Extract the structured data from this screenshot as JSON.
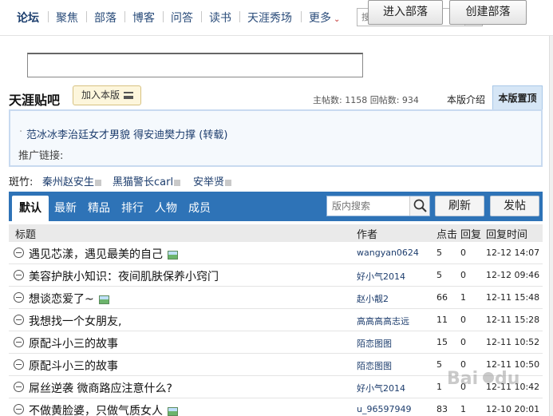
{
  "nav": {
    "items": [
      "论坛",
      "聚焦",
      "部落",
      "博客",
      "问答",
      "读书",
      "天涯秀场",
      "更多"
    ],
    "more_arrow": "⌄",
    "search_placeholder": "搜帖、找人、搜版块"
  },
  "create_bar": {
    "input_value": "",
    "enter_label": "进入部落",
    "create_label": "创建部落"
  },
  "board": {
    "title": "天涯贴吧",
    "join_label": "加入本版",
    "stats": "主帖数: 1158  回帖数: 934",
    "tab_intro": "本版介绍",
    "tab_settings": "本版置顶"
  },
  "notice": {
    "link_text": "范冰冰李治廷女才男貌 得安迪樊力撑 (转载)",
    "promo_label": "推广链接:"
  },
  "moderators": {
    "label": "斑竹:",
    "names": [
      "秦州赵安生",
      "黑猫警长carl",
      "安举贤"
    ]
  },
  "tabs": {
    "items": [
      "默认",
      "最新",
      "精品",
      "排行",
      "人物",
      "成员"
    ],
    "search_placeholder": "版内搜索",
    "refresh_label": "刷新",
    "post_label": "发帖"
  },
  "table": {
    "headers": {
      "title": "标题",
      "author": "作者",
      "clicks": "点击",
      "replies": "回复",
      "time": "回复时间"
    },
    "rows": [
      {
        "title": "遇见芯漾，遇见最美的自己",
        "has_image": true,
        "author": "wangyan0624",
        "clicks": "5",
        "replies": "0",
        "time": "12-12 14:07"
      },
      {
        "title": "美容护肤小知识：夜间肌肤保养小窍门",
        "has_image": false,
        "author": "好小气2014",
        "clicks": "5",
        "replies": "0",
        "time": "12-12 09:46"
      },
      {
        "title": "想谈恋爱了~",
        "has_image": true,
        "author": "赵小靓2",
        "clicks": "66",
        "replies": "1",
        "time": "12-11 15:48"
      },
      {
        "title": "我想找一个女朋友,",
        "has_image": false,
        "author": "高高高高志远",
        "clicks": "11",
        "replies": "0",
        "time": "12-11 15:28"
      },
      {
        "title": "原配斗小三的故事",
        "has_image": false,
        "author": "陌恋图图",
        "clicks": "15",
        "replies": "0",
        "time": "12-11 10:52"
      },
      {
        "title": "原配斗小三的故事",
        "has_image": false,
        "author": "陌恋图图",
        "clicks": "5",
        "replies": "0",
        "time": "12-11 10:50"
      },
      {
        "title": "屌丝逆袭 微商路应注意什么?",
        "has_image": false,
        "author": "好小气2014",
        "clicks": "1",
        "replies": "0",
        "time": "12-11 10:42"
      },
      {
        "title": "不做黄脸婆，只做气质女人",
        "has_image": true,
        "author": "u_96597949",
        "clicks": "83",
        "replies": "1",
        "time": "12-10 20:01"
      }
    ]
  },
  "colors": {
    "tabbar": "#2e73b7",
    "link": "#1e3e6e",
    "notice_bg": "#f5f9fd"
  }
}
